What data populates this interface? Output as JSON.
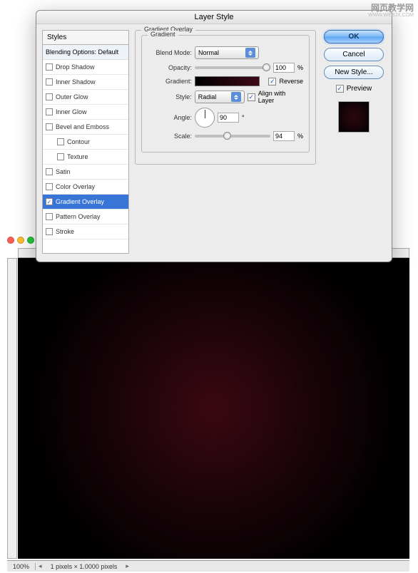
{
  "watermark": {
    "main": "网页教学网",
    "sub": "WWW.WEBJX.COM"
  },
  "dialog": {
    "title": "Layer Style",
    "sidebar": {
      "header": "Styles",
      "blending": "Blending Options: Default",
      "items": [
        {
          "label": "Drop Shadow",
          "checked": false,
          "indent": false
        },
        {
          "label": "Inner Shadow",
          "checked": false,
          "indent": false
        },
        {
          "label": "Outer Glow",
          "checked": false,
          "indent": false
        },
        {
          "label": "Inner Glow",
          "checked": false,
          "indent": false
        },
        {
          "label": "Bevel and Emboss",
          "checked": false,
          "indent": false
        },
        {
          "label": "Contour",
          "checked": false,
          "indent": true
        },
        {
          "label": "Texture",
          "checked": false,
          "indent": true
        },
        {
          "label": "Satin",
          "checked": false,
          "indent": false
        },
        {
          "label": "Color Overlay",
          "checked": false,
          "indent": false
        },
        {
          "label": "Gradient Overlay",
          "checked": true,
          "indent": false,
          "selected": true
        },
        {
          "label": "Pattern Overlay",
          "checked": false,
          "indent": false
        },
        {
          "label": "Stroke",
          "checked": false,
          "indent": false
        }
      ]
    },
    "settings": {
      "section_title": "Gradient Overlay",
      "group_title": "Gradient",
      "blend_mode": {
        "label": "Blend Mode:",
        "value": "Normal"
      },
      "opacity": {
        "label": "Opacity:",
        "value": "100",
        "unit": "%",
        "pos": 100
      },
      "gradient": {
        "label": "Gradient:",
        "reverse_label": "Reverse",
        "reverse_checked": true
      },
      "style": {
        "label": "Style:",
        "value": "Radial",
        "align_label": "Align with Layer",
        "align_checked": true
      },
      "angle": {
        "label": "Angle:",
        "value": "90",
        "unit": "°"
      },
      "scale": {
        "label": "Scale:",
        "value": "94",
        "unit": "%",
        "pos": 38
      }
    },
    "actions": {
      "ok": "OK",
      "cancel": "Cancel",
      "new_style": "New Style...",
      "preview_label": "Preview",
      "preview_checked": true
    }
  },
  "ps": {
    "zoom": "100%",
    "doc_info": "1 pixels × 1.0000 pixels"
  }
}
